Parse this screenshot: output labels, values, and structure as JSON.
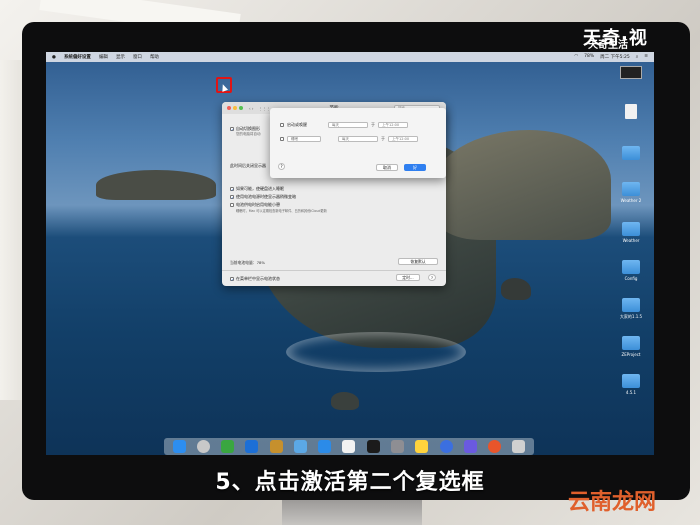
{
  "overlay": {
    "logo_text": "天奇·视",
    "logo_sub": "天奇生活",
    "caption": "5、点击激活第二个复选框",
    "watermark": "云南龙网"
  },
  "menubar": {
    "app_name": "系统偏好设置",
    "items": [
      "编辑",
      "显示",
      "窗口",
      "帮助"
    ],
    "battery": "78%",
    "clock": "周二 下午5:25"
  },
  "prefs_window": {
    "title": "节能",
    "search_placeholder": "搜索",
    "option_1": "自动切换图形",
    "option_1_sub": "您的电脑将自动",
    "display_sleep_label": "此时间后关闭显示器",
    "slider_end": "永不",
    "slider_mid": "3 小时",
    "options": [
      "如果可能，使硬盘进入睡眠",
      "使用电池电源时使显示器稍微变暗",
      "电池供电时启用电能小憩"
    ],
    "power_nap_note": "睡眠时，Mac 可以定期检查新电子邮件、日历和其他iCloud更新",
    "battery_status": "当前电池电量：78%",
    "restore_button": "恢复默认",
    "show_battery": "在菜单栏中显示电池状态",
    "schedule_button": "定时…",
    "help": "?"
  },
  "schedule_sheet": {
    "row1_label": "启动或唤醒",
    "row1_day": "每天",
    "row1_at": "于",
    "row1_time": "上午12:00",
    "row2_action": "睡眠",
    "row2_day": "每天",
    "row2_at": "于",
    "row2_time": "上午12:00",
    "help": "?",
    "cancel_button": "取消",
    "ok_button": "好"
  },
  "desktop_icons": [
    {
      "label": "",
      "type": "screenshot"
    },
    {
      "label": "",
      "type": "file"
    },
    {
      "label": "",
      "type": "folder"
    },
    {
      "label": "Weather 2",
      "type": "folder"
    },
    {
      "label": "Weather",
      "type": "folder"
    },
    {
      "label": "Config",
      "type": "folder"
    },
    {
      "label": "大家的1.1.5",
      "type": "folder"
    },
    {
      "label": "ZEProject",
      "type": "folder"
    },
    {
      "label": "4.5.1",
      "type": "folder"
    }
  ],
  "colors": {
    "accent": "#1a5ccc",
    "highlight": "#e01515",
    "watermark": "#e0602c"
  }
}
